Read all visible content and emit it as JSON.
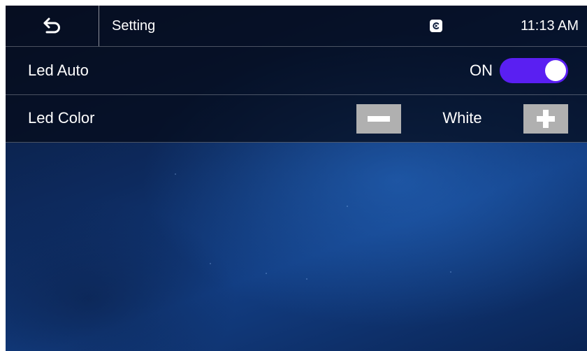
{
  "header": {
    "back_icon": "back-arrow-icon",
    "title": "Setting",
    "cast_icon": "screen-cast-icon",
    "time": "11:13 AM"
  },
  "settings": {
    "led_auto": {
      "label": "Led Auto",
      "state_label": "ON",
      "enabled": true
    },
    "led_color": {
      "label": "Led Color",
      "value": "White",
      "decrease_icon": "minus-icon",
      "increase_icon": "plus-icon"
    }
  },
  "colors": {
    "toggle_on": "#5a1ff2",
    "stepper_button": "#b0b0b0",
    "background": "#0d2a5e"
  }
}
